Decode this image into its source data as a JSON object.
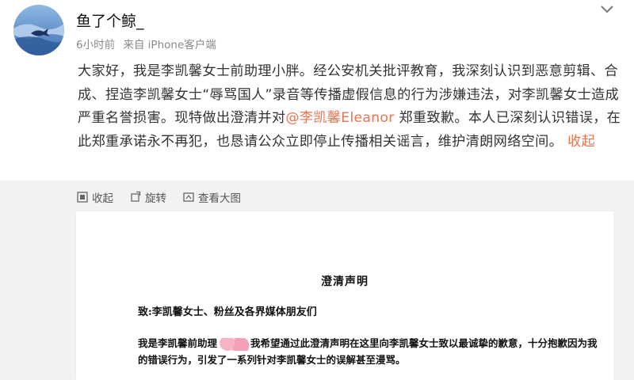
{
  "user": {
    "name": "鱼了个鲸_",
    "time": "6小时前",
    "source": "来自 iPhone客户端"
  },
  "post": {
    "text_before": "大家好，我是李凯馨女士前助理小胖。经公安机关批评教育，我深刻认识到恶意剪辑、合成、捏造李凯馨女士“辱骂国人”录音等传播虚假信息的行为涉嫌违法，对李凯馨女士造成严重名誉损害。现特做出澄清并对",
    "mention": "@李凯馨Eleanor",
    "text_after": " 郑重致歉。本人已深刻认识错误，在此郑重承诺永不再犯，也恳请公众立即停止传播相关谣言，维护清朗网络空间。",
    "collapse": "收起"
  },
  "toolbar": {
    "collapse": "收起",
    "rotate": "旋转",
    "view_large": "查看大图"
  },
  "document": {
    "title": "澄清声明",
    "greeting": "致:李凯馨女士、粉丝及各界媒体朋友们",
    "body_part1": "我是李凯馨前助理",
    "body_part2": "我希望通过此澄清声明在这里向李凯馨女士致以最诚挚的歉意，十分抱歉因为我的错误行为，引发了一系列针对李凯馨女士的误解甚至漫骂。"
  },
  "colors": {
    "accent": "#eb7350",
    "text": "#333333",
    "meta": "#8a8a8a"
  }
}
